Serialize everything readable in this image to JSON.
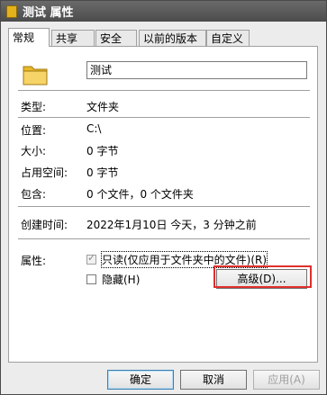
{
  "window": {
    "title": "测试 属性"
  },
  "tabs": [
    {
      "label": "常规"
    },
    {
      "label": "共享"
    },
    {
      "label": "安全"
    },
    {
      "label": "以前的版本"
    },
    {
      "label": "自定义"
    }
  ],
  "general": {
    "folder_name": "测试",
    "type_label": "类型:",
    "type_value": "文件夹",
    "location_label": "位置:",
    "location_value": "C:\\",
    "size_label": "大小:",
    "size_value": "0 字节",
    "size_on_disk_label": "占用空间:",
    "size_on_disk_value": "0 字节",
    "contains_label": "包含:",
    "contains_value": "0 个文件，0 个文件夹",
    "created_label": "创建时间:",
    "created_value": "2022年1月10日 今天，3 分钟之前",
    "attributes_label": "属性:",
    "readonly_label": "只读(仅应用于文件夹中的文件)(R)",
    "hidden_label": "隐藏(H)",
    "advanced_button": "高级(D)..."
  },
  "buttons": {
    "ok": "确定",
    "cancel": "取消",
    "apply": "应用(A)"
  },
  "colors": {
    "annotation": "#e0302c",
    "folder": "#e3b21c"
  }
}
